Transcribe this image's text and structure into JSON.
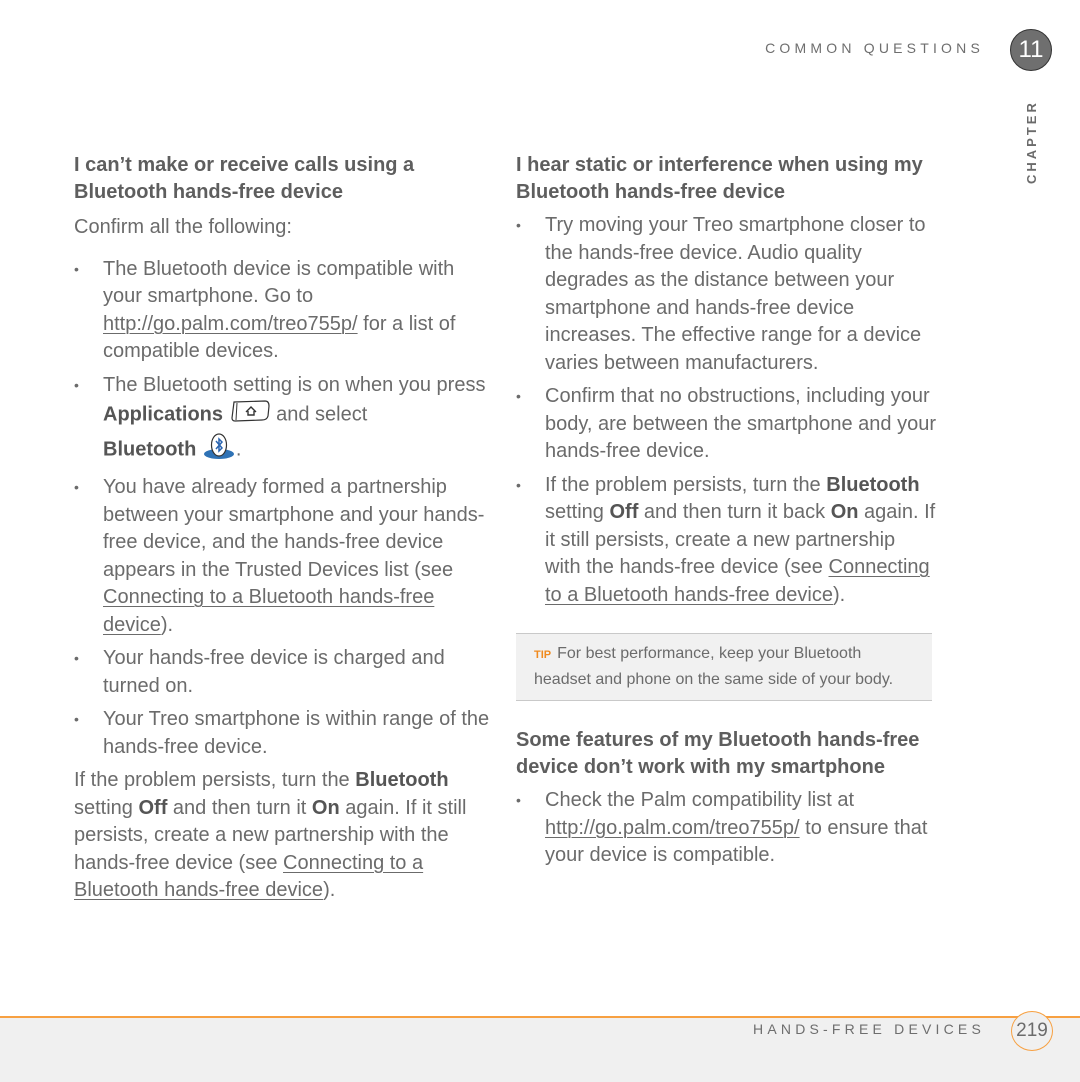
{
  "header": {
    "section_label": "COMMON QUESTIONS",
    "chapter_number": "11",
    "chapter_label": "CHAPTER"
  },
  "left": {
    "heading": "I can’t make or receive calls using a Bluetooth hands-free device",
    "intro": "Confirm all the following:",
    "bullets": [
      {
        "t1": "The Bluetooth device is compatible with your smartphone. Go to ",
        "link": "http://go.palm.com/treo755p/",
        "t2": " for a list of compatible devices."
      },
      {
        "t1": "The Bluetooth setting is on when you press ",
        "b1": "Applications",
        "t2": " and select ",
        "b2": "Bluetooth",
        "t3": ".",
        "icon1": "applications-button-icon",
        "icon2": "bluetooth-app-icon"
      },
      {
        "t1": "You have already formed a partnership between your smartphone and your hands-free device, and the hands-free device appears in the Trusted Devices list (see ",
        "link": "Connecting to a Bluetooth hands-free device",
        "t2": ")."
      },
      {
        "t1": "Your hands-free device is charged and turned on."
      },
      {
        "t1": "Your Treo smartphone is within range of the hands-free device."
      }
    ],
    "closing": {
      "t1": "If the problem persists, turn the ",
      "b1": "Bluetooth",
      "t2": " setting ",
      "b2": "Off",
      "t3": " and then turn it ",
      "b3": "On",
      "t4": " again. If it still persists, create a new partnership with the hands-free device (see ",
      "link": "Connecting to a Bluetooth hands-free device",
      "t5": ")."
    }
  },
  "right": {
    "heading1": "I hear static or interference when using my Bluetooth hands-free device",
    "bullets1": [
      {
        "t1": "Try moving your Treo smartphone closer to the hands-free device. Audio quality degrades as the distance between your smartphone and hands-free device increases. The effective range for a device varies between manufacturers."
      },
      {
        "t1": "Confirm that no obstructions, including your body, are between the smartphone and your hands-free device."
      },
      {
        "t1": "If the problem persists, turn the ",
        "b1": "Bluetooth",
        "t2": " setting ",
        "b2": "Off",
        "t3": " and then turn it back ",
        "b3": "On",
        "t4": " again. If it still persists, create a new partnership with the hands-free device (see ",
        "link": "Connecting to a Bluetooth hands-free device",
        "t5": ")."
      }
    ],
    "tip": {
      "label": "TIP",
      "text": "For best performance, keep your Bluetooth headset and phone on the same side of your body."
    },
    "heading2": "Some features of my Bluetooth hands-free device don’t work with my smartphone",
    "bullets2": [
      {
        "t1": "Check the Palm compatibility list at ",
        "link": "http://go.palm.com/treo755p/",
        "t2": " to ensure that your device is compatible."
      }
    ]
  },
  "footer": {
    "section_label": "HANDS-FREE DEVICES",
    "page_number": "219"
  },
  "colors": {
    "accent_orange": "#f7a041",
    "tip_orange": "#f08a1e",
    "text_gray": "#6b6b6b",
    "footer_bg": "#f0f0f0"
  }
}
